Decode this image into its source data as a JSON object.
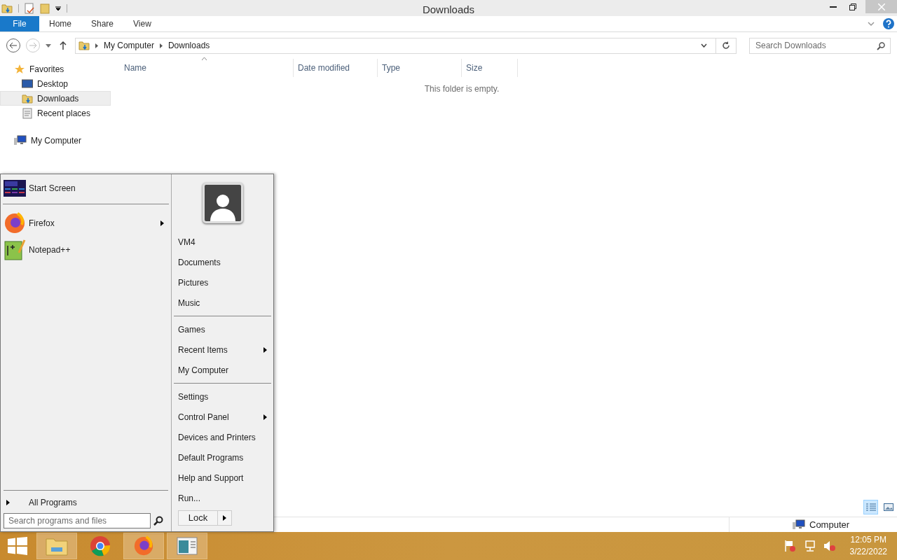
{
  "window": {
    "title": "Downloads"
  },
  "ribbon_tabs": [
    {
      "label": "File",
      "kind": "file"
    },
    {
      "label": "Home",
      "kind": "tab"
    },
    {
      "label": "Share",
      "kind": "tab"
    },
    {
      "label": "View",
      "kind": "tab"
    }
  ],
  "address": {
    "path": [
      "My Computer",
      "Downloads"
    ]
  },
  "search": {
    "placeholder": "Search Downloads"
  },
  "nav": [
    {
      "label": "Favorites",
      "kind": "star",
      "children": [
        {
          "label": "Desktop",
          "kind": "desktop",
          "selected": false
        },
        {
          "label": "Downloads",
          "kind": "downloads",
          "selected": true
        },
        {
          "label": "Recent places",
          "kind": "recent",
          "selected": false
        }
      ]
    },
    {
      "label": "My Computer",
      "kind": "computer"
    }
  ],
  "columns": [
    {
      "label": "Name",
      "sorted": true
    },
    {
      "label": "Date modified",
      "sorted": false
    },
    {
      "label": "Type",
      "sorted": false
    },
    {
      "label": "Size",
      "sorted": false
    }
  ],
  "empty_message": "This folder is empty.",
  "view_buttons": [
    {
      "kind": "details",
      "selected": true
    },
    {
      "kind": "large_icons",
      "selected": false
    }
  ],
  "status_bar": {
    "location": "Computer"
  },
  "start_menu": {
    "program_groups": [
      [
        {
          "label": "Start Screen",
          "kind": "start",
          "submenu": false
        }
      ],
      [
        {
          "label": "Firefox",
          "kind": "firefox",
          "submenu": true
        },
        {
          "label": "Notepad++",
          "kind": "notepad",
          "submenu": false
        }
      ]
    ],
    "all_programs": "All Programs",
    "search": {
      "placeholder": "Search programs and files"
    },
    "right_groups": [
      [
        {
          "label": "VM4",
          "submenu": false
        },
        {
          "label": "Documents",
          "submenu": false
        },
        {
          "label": "Pictures",
          "submenu": false
        },
        {
          "label": "Music",
          "submenu": false
        }
      ],
      [
        {
          "label": "Games",
          "submenu": false
        },
        {
          "label": "Recent Items",
          "submenu": true
        },
        {
          "label": "My Computer",
          "submenu": false
        }
      ],
      [
        {
          "label": "Settings",
          "submenu": false
        },
        {
          "label": "Control Panel",
          "submenu": true
        },
        {
          "label": "Devices and Printers",
          "submenu": false
        },
        {
          "label": "Default Programs",
          "submenu": false
        },
        {
          "label": "Help and Support",
          "submenu": false
        },
        {
          "label": "Run...",
          "submenu": false
        }
      ]
    ],
    "power": {
      "label": "Lock"
    }
  },
  "taskbar": {
    "apps": [
      {
        "kind": "explorer",
        "running": true
      },
      {
        "kind": "chrome",
        "running": false
      },
      {
        "kind": "firefox",
        "running": true
      },
      {
        "kind": "window",
        "running": true
      }
    ],
    "clock": {
      "time": "12:05 PM",
      "date": "3/22/2022"
    }
  }
}
